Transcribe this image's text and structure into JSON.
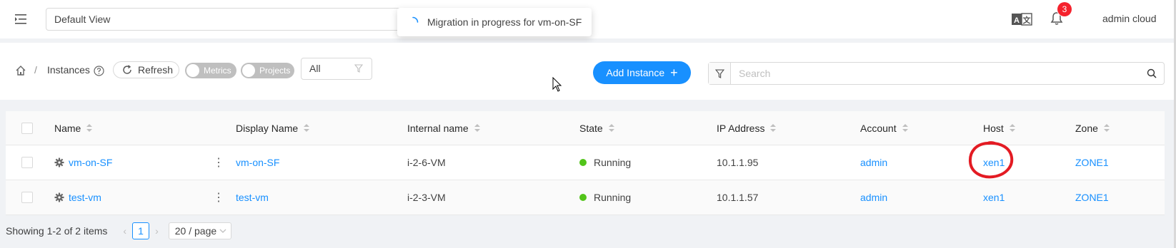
{
  "header": {
    "view_select": "Default View",
    "toast_message": "Migration in progress for vm-on-SF",
    "notification_count": "3",
    "user_name": "admin cloud"
  },
  "toolbar": {
    "breadcrumb_sep": "/",
    "breadcrumb_label": "Instances",
    "refresh_label": "Refresh",
    "metrics_label": "Metrics",
    "projects_label": "Projects",
    "filter_value": "All",
    "add_label": "Add Instance",
    "search_placeholder": "Search"
  },
  "table": {
    "columns": [
      "Name",
      "Display Name",
      "Internal name",
      "State",
      "IP Address",
      "Account",
      "Host",
      "Zone"
    ],
    "rows": [
      {
        "name": "vm-on-SF",
        "display_name": "vm-on-SF",
        "internal_name": "i-2-6-VM",
        "state": "Running",
        "ip": "10.1.1.95",
        "account": "admin",
        "host": "xen1",
        "zone": "ZONE1"
      },
      {
        "name": "test-vm",
        "display_name": "test-vm",
        "internal_name": "i-2-3-VM",
        "state": "Running",
        "ip": "10.1.1.57",
        "account": "admin",
        "host": "xen1",
        "zone": "ZONE1"
      }
    ],
    "state_color": "#52c41a",
    "annotation_color": "#e31b23"
  },
  "pagination": {
    "total_text": "Showing 1-2 of 2 items",
    "current_page": "1",
    "page_size": "20 / page"
  },
  "colors": {
    "primary": "#1890ff",
    "badge": "#f5222d"
  }
}
